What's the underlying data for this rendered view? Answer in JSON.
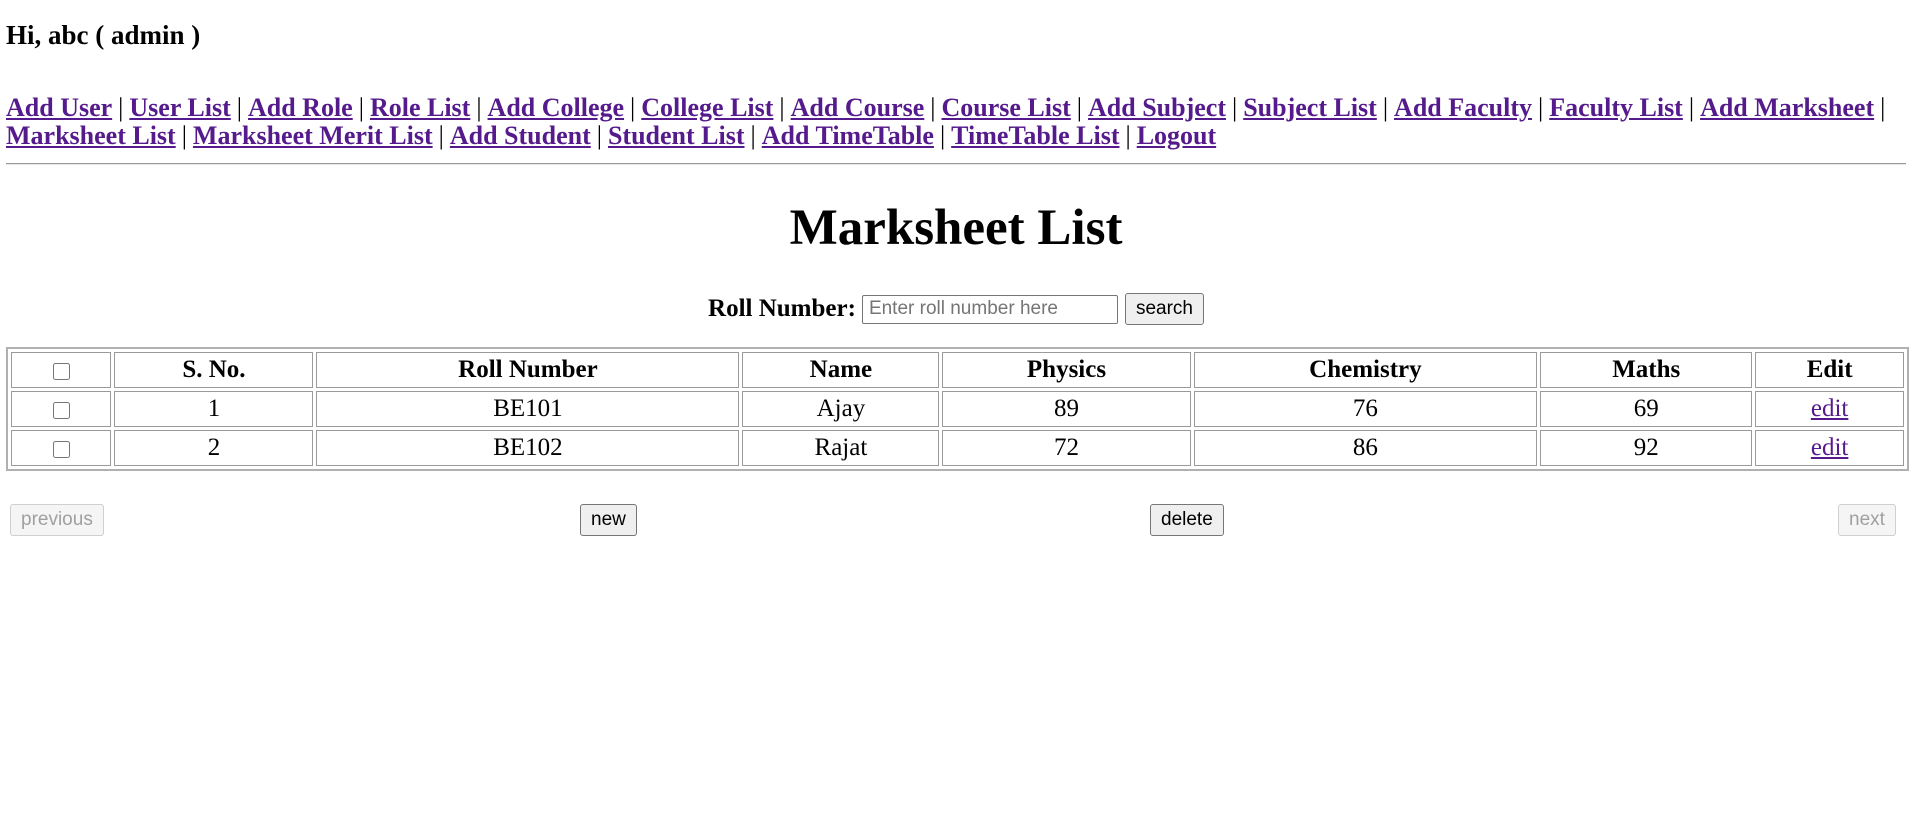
{
  "header": {
    "greeting": "Hi, abc ( admin )"
  },
  "nav": {
    "items": [
      "Add User",
      "User List",
      "Add Role",
      "Role List",
      "Add College",
      "College List",
      "Add Course",
      "Course List",
      "Add Subject",
      "Subject List",
      "Add Faculty",
      "Faculty List",
      "Add Marksheet",
      "Marksheet List",
      "Marksheet Merit List",
      "Add Student",
      "Student List",
      "Add TimeTable",
      "TimeTable List",
      "Logout"
    ],
    "separator": "|"
  },
  "page": {
    "title": "Marksheet List"
  },
  "search": {
    "label": "Roll Number:",
    "placeholder": "Enter roll number here",
    "value": "",
    "button": "search"
  },
  "table": {
    "headers": [
      "S. No.",
      "Roll Number",
      "Name",
      "Physics",
      "Chemistry",
      "Maths",
      "Edit"
    ],
    "rows": [
      {
        "sno": "1",
        "roll": "BE101",
        "name": "Ajay",
        "physics": "89",
        "chemistry": "76",
        "maths": "69",
        "edit": "edit"
      },
      {
        "sno": "2",
        "roll": "BE102",
        "name": "Rajat",
        "physics": "72",
        "chemistry": "86",
        "maths": "92",
        "edit": "edit"
      }
    ]
  },
  "pager": {
    "previous": "previous",
    "new": "new",
    "delete": "delete",
    "next": "next"
  },
  "colors": {
    "link": "#551a8b",
    "border": "#9a9a9a"
  }
}
